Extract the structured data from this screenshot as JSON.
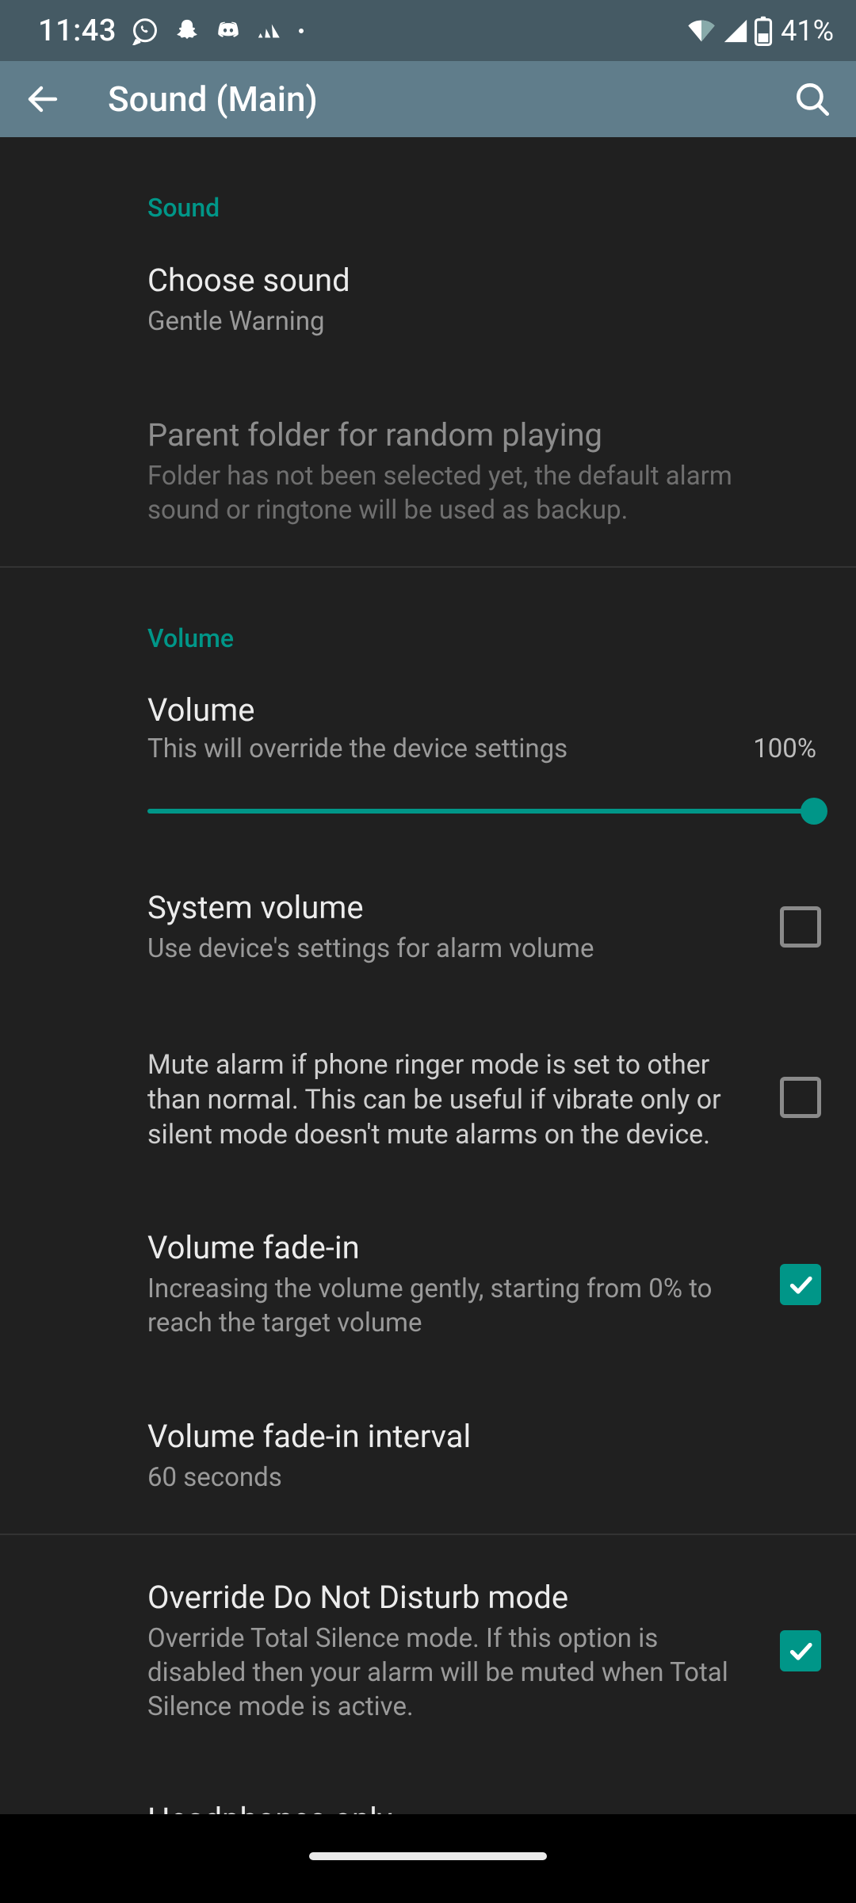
{
  "status": {
    "time": "11:43",
    "battery_text": "41%"
  },
  "appbar": {
    "title": "Sound (Main)"
  },
  "sections": {
    "sound": {
      "header": "Sound",
      "choose_sound": {
        "title": "Choose sound",
        "value": "Gentle Warning"
      },
      "parent_folder": {
        "title": "Parent folder for random playing",
        "desc": "Folder has not been selected yet, the default alarm sound or ringtone will be used as backup."
      }
    },
    "volume": {
      "header": "Volume",
      "volume": {
        "title": "Volume",
        "desc": "This will override the device settings",
        "pct": "100%"
      },
      "system_volume": {
        "title": "System volume",
        "desc": "Use device's settings for alarm volume",
        "checked": false
      },
      "mute_ringer": {
        "desc": "Mute alarm if phone ringer mode is set to other than normal. This can be useful if vibrate only or silent mode doesn't mute alarms on the device.",
        "checked": false
      },
      "fade_in": {
        "title": "Volume fade-in",
        "desc": "Increasing the volume gently, starting from 0% to reach the target volume",
        "checked": true
      },
      "fade_in_interval": {
        "title": "Volume fade-in interval",
        "value": "60 seconds"
      }
    },
    "dnd": {
      "override": {
        "title": "Override Do Not Disturb mode",
        "desc": "Override Total Silence mode. If this option is disabled then your alarm will be muted when Total Silence mode is active.",
        "checked": true
      },
      "headphones": {
        "title": "Headphones only"
      }
    }
  }
}
